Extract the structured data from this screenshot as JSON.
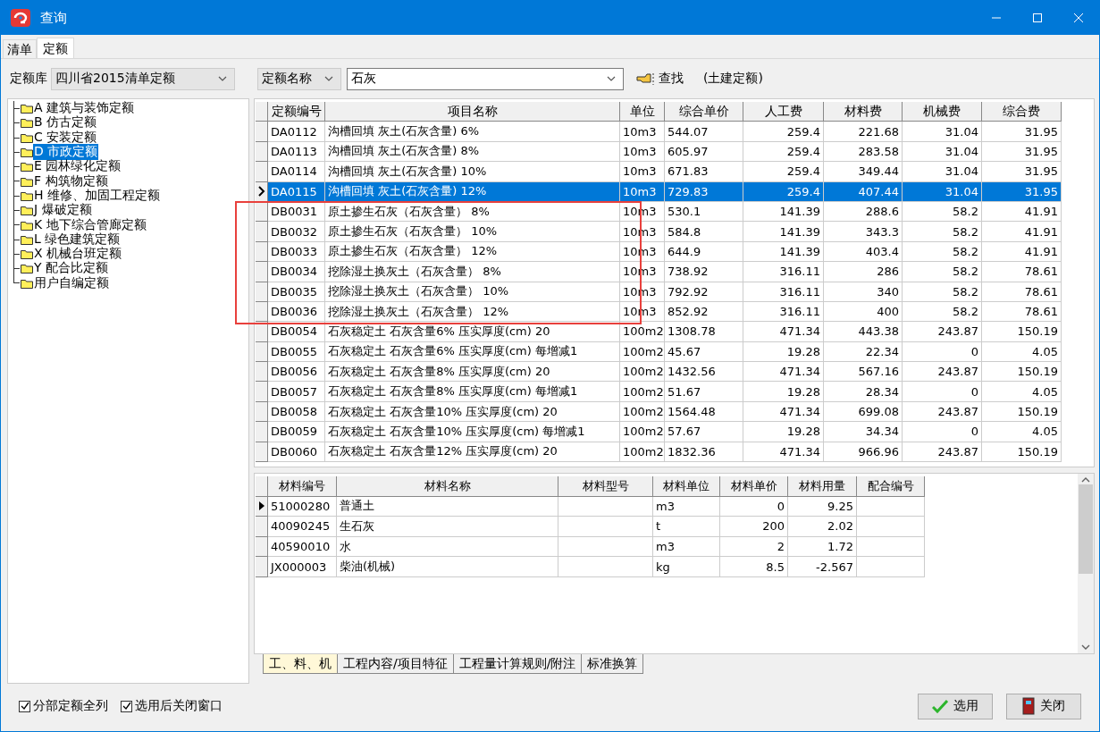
{
  "window": {
    "title": "查询"
  },
  "tabs": [
    {
      "label": "清单",
      "selected": false
    },
    {
      "label": "定额",
      "selected": true
    }
  ],
  "library": {
    "label": "定额库",
    "value": "四川省2015清单定额"
  },
  "search": {
    "field": "定额名称",
    "value": "石灰",
    "button": "查找",
    "note": "(土建定额)"
  },
  "tree": [
    {
      "label": "A 建筑与装饰定额",
      "selected": false
    },
    {
      "label": "B 仿古定额",
      "selected": false
    },
    {
      "label": "C 安装定额",
      "selected": false
    },
    {
      "label": "D 市政定额",
      "selected": true
    },
    {
      "label": "E 园林绿化定额",
      "selected": false
    },
    {
      "label": "F 构筑物定额",
      "selected": false
    },
    {
      "label": "H 维修、加固工程定额",
      "selected": false
    },
    {
      "label": "J 爆破定额",
      "selected": false
    },
    {
      "label": "K 地下综合管廊定额",
      "selected": false
    },
    {
      "label": "L 绿色建筑定额",
      "selected": false
    },
    {
      "label": "X 机械台班定额",
      "selected": false
    },
    {
      "label": "Y 配合比定额",
      "selected": false
    },
    {
      "label": "用户自编定额",
      "selected": false
    }
  ],
  "quota_table": {
    "columns": [
      "定额编号",
      "项目名称",
      "单位",
      "综合单价",
      "人工费",
      "材料费",
      "机械费",
      "综合费"
    ],
    "rows": [
      {
        "selected": false,
        "cells": [
          "DA0112",
          "沟槽回填 灰土(石灰含量) 6%",
          "10m3",
          "544.07",
          "259.4",
          "221.68",
          "31.04",
          "31.95"
        ]
      },
      {
        "selected": false,
        "cells": [
          "DA0113",
          "沟槽回填 灰土(石灰含量) 8%",
          "10m3",
          "605.97",
          "259.4",
          "283.58",
          "31.04",
          "31.95"
        ]
      },
      {
        "selected": false,
        "cells": [
          "DA0114",
          "沟槽回填 灰土(石灰含量) 10%",
          "10m3",
          "671.83",
          "259.4",
          "349.44",
          "31.04",
          "31.95"
        ]
      },
      {
        "selected": true,
        "cells": [
          "DA0115",
          "沟槽回填 灰土(石灰含量) 12%",
          "10m3",
          "729.83",
          "259.4",
          "407.44",
          "31.04",
          "31.95"
        ]
      },
      {
        "selected": false,
        "cells": [
          "DB0031",
          "原土掺生石灰（石灰含量） 8%",
          "10m3",
          "530.1",
          "141.39",
          "288.6",
          "58.2",
          "41.91"
        ]
      },
      {
        "selected": false,
        "cells": [
          "DB0032",
          "原土掺生石灰（石灰含量） 10%",
          "10m3",
          "584.8",
          "141.39",
          "343.3",
          "58.2",
          "41.91"
        ]
      },
      {
        "selected": false,
        "cells": [
          "DB0033",
          "原土掺生石灰（石灰含量） 12%",
          "10m3",
          "644.9",
          "141.39",
          "403.4",
          "58.2",
          "41.91"
        ]
      },
      {
        "selected": false,
        "cells": [
          "DB0034",
          "挖除湿土换灰土（石灰含量） 8%",
          "10m3",
          "738.92",
          "316.11",
          "286",
          "58.2",
          "78.61"
        ]
      },
      {
        "selected": false,
        "cells": [
          "DB0035",
          "挖除湿土换灰土（石灰含量） 10%",
          "10m3",
          "792.92",
          "316.11",
          "340",
          "58.2",
          "78.61"
        ]
      },
      {
        "selected": false,
        "cells": [
          "DB0036",
          "挖除湿土换灰土（石灰含量） 12%",
          "10m3",
          "852.92",
          "316.11",
          "400",
          "58.2",
          "78.61"
        ]
      },
      {
        "selected": false,
        "cells": [
          "DB0054",
          "石灰稳定土 石灰含量6% 压实厚度(cm) 20",
          "100m2",
          "1308.78",
          "471.34",
          "443.38",
          "243.87",
          "150.19"
        ]
      },
      {
        "selected": false,
        "cells": [
          "DB0055",
          "石灰稳定土 石灰含量6% 压实厚度(cm) 每增减1",
          "100m2",
          "45.67",
          "19.28",
          "22.34",
          "0",
          "4.05"
        ]
      },
      {
        "selected": false,
        "cells": [
          "DB0056",
          "石灰稳定土 石灰含量8% 压实厚度(cm) 20",
          "100m2",
          "1432.56",
          "471.34",
          "567.16",
          "243.87",
          "150.19"
        ]
      },
      {
        "selected": false,
        "cells": [
          "DB0057",
          "石灰稳定土 石灰含量8% 压实厚度(cm) 每增减1",
          "100m2",
          "51.67",
          "19.28",
          "28.34",
          "0",
          "4.05"
        ]
      },
      {
        "selected": false,
        "cells": [
          "DB0058",
          "石灰稳定土 石灰含量10% 压实厚度(cm) 20",
          "100m2",
          "1564.48",
          "471.34",
          "699.08",
          "243.87",
          "150.19"
        ]
      },
      {
        "selected": false,
        "cells": [
          "DB0059",
          "石灰稳定土 石灰含量10% 压实厚度(cm) 每增减1",
          "100m2",
          "57.67",
          "19.28",
          "34.34",
          "0",
          "4.05"
        ]
      },
      {
        "selected": false,
        "cells": [
          "DB0060",
          "石灰稳定土 石灰含量12% 压实厚度(cm) 20",
          "100m2",
          "1832.36",
          "471.34",
          "966.96",
          "243.87",
          "150.19"
        ]
      }
    ]
  },
  "material_table": {
    "columns": [
      "材料编号",
      "材料名称",
      "材料型号",
      "材料单位",
      "材料单价",
      "材料用量",
      "配合编号"
    ],
    "rows": [
      {
        "selected": true,
        "cells": [
          "51000280",
          "普通土",
          "",
          "m3",
          "0",
          "9.25",
          ""
        ]
      },
      {
        "selected": false,
        "cells": [
          "40090245",
          "生石灰",
          "",
          "t",
          "200",
          "2.02",
          ""
        ]
      },
      {
        "selected": false,
        "cells": [
          "40590010",
          "水",
          "",
          "m3",
          "2",
          "1.72",
          ""
        ]
      },
      {
        "selected": false,
        "cells": [
          "JX000003",
          "柴油(机械)",
          "",
          "kg",
          "8.5",
          "-2.567",
          ""
        ]
      }
    ]
  },
  "detail_tabs": [
    {
      "label": "工、料、机",
      "selected": true
    },
    {
      "label": "工程内容/项目特征",
      "selected": false
    },
    {
      "label": "工程量计算规则/附注",
      "selected": false
    },
    {
      "label": "标准换算",
      "selected": false
    }
  ],
  "options": [
    {
      "label": "分部定额全列",
      "checked": true
    },
    {
      "label": "选用后关闭窗口",
      "checked": true
    }
  ],
  "buttons": [
    {
      "label": "选用",
      "kind": "select"
    },
    {
      "label": "关闭",
      "kind": "close"
    }
  ]
}
